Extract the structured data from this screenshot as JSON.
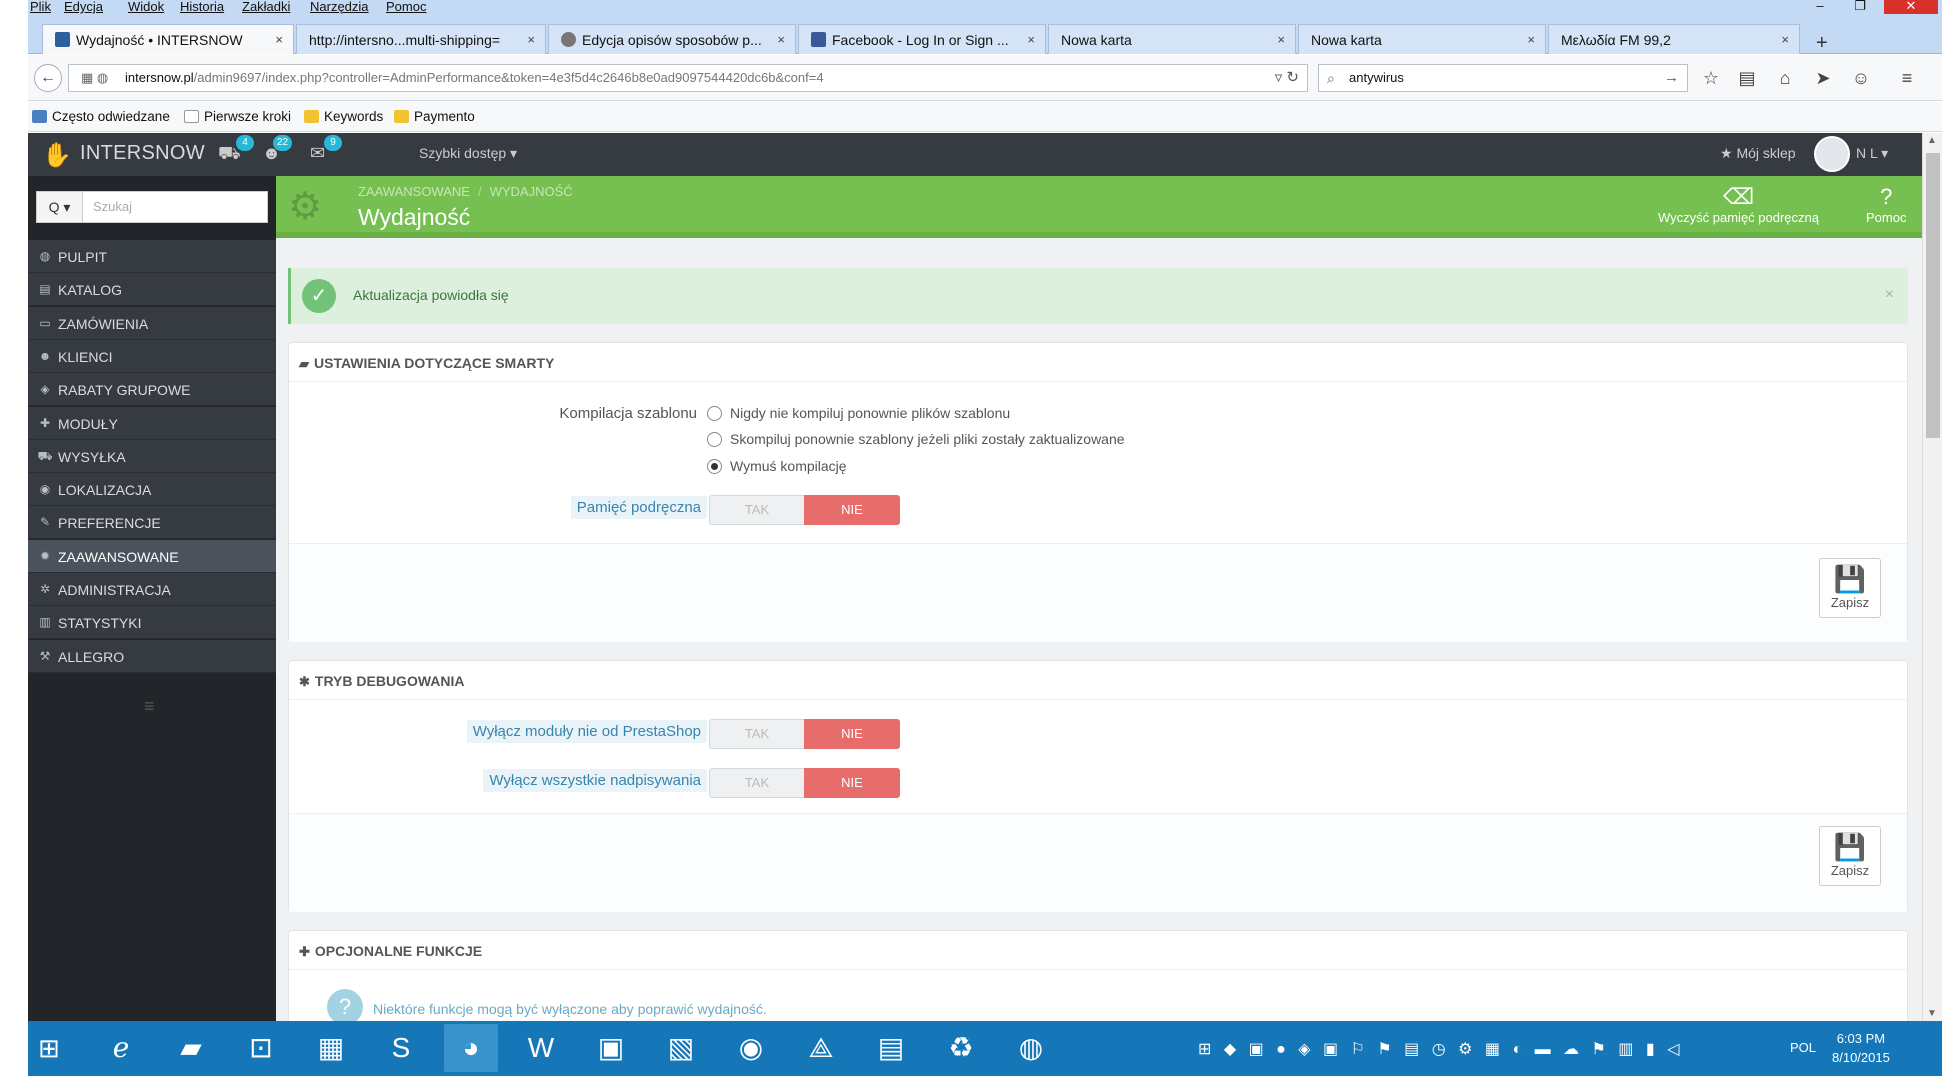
{
  "browser": {
    "menu": [
      "Plik",
      "Edycja",
      "Widok",
      "Historia",
      "Zakładki",
      "Narzędzia",
      "Pomoc"
    ],
    "window_controls": {
      "minimize": "–",
      "restore": "❐",
      "close": "✕"
    },
    "tabs": [
      {
        "label": "Wydajność • INTERSNOW",
        "icon_color": "#2d5f9e"
      },
      {
        "label": "http://intersno...multi-shipping=",
        "icon_color": ""
      },
      {
        "label": "Edycja opisów sposobów p...",
        "icon_color": "#777777"
      },
      {
        "label": "Facebook - Log In or Sign ...",
        "icon_color": "#3b5998"
      },
      {
        "label": "Nowa karta",
        "icon_color": ""
      },
      {
        "label": "Nowa karta",
        "icon_color": ""
      },
      {
        "label": "Μελωδία FM 99,2",
        "icon_color": ""
      }
    ],
    "tab_close": "×",
    "new_tab": "+",
    "url_host": "intersnow.pl",
    "url_path": "/admin9697/index.php?controller=AdminPerformance&token=4e3f5d4c2646b8e0ad9097544420dc6b&conf=4",
    "search_value": "antywirus",
    "bookmarks": [
      {
        "label": "Często odwiedzane",
        "icon_color": "#4a7fc1"
      },
      {
        "label": "Pierwsze kroki",
        "icon_color": "#ffffff"
      },
      {
        "label": "Keywords",
        "icon_color": "#f1c232"
      },
      {
        "label": "Paymento",
        "icon_color": "#f1c232"
      }
    ]
  },
  "admin": {
    "shop_name": "INTERSNOW",
    "badges": {
      "orders": "4",
      "customers": "22",
      "messages": "9"
    },
    "quick_access": "Szybki dostęp ▾",
    "my_shop": "★ Mój sklep",
    "user": "N L ▾",
    "search_placeholder": "Szukaj",
    "search_button": "Q ▾",
    "sidebar": [
      {
        "label": "PULPIT",
        "icon": "◍",
        "icon_name": "dashboard-icon"
      },
      {
        "label": "KATALOG",
        "icon": "▤",
        "icon_name": "catalog-icon"
      },
      {
        "label": "ZAMÓWIENIA",
        "icon": "▭",
        "icon_name": "orders-icon"
      },
      {
        "label": "KLIENCI",
        "icon": "☻",
        "icon_name": "customers-icon"
      },
      {
        "label": "RABATY GRUPOWE",
        "icon": "◈",
        "icon_name": "tag-icon"
      },
      {
        "label": "MODUŁY",
        "icon": "✚",
        "icon_name": "puzzle-icon"
      },
      {
        "label": "WYSYŁKA",
        "icon": "⛟",
        "icon_name": "truck-icon"
      },
      {
        "label": "LOKALIZACJA",
        "icon": "◉",
        "icon_name": "globe-icon"
      },
      {
        "label": "PREFERENCJE",
        "icon": "✎",
        "icon_name": "wrench-icon"
      },
      {
        "label": "ZAAWANSOWANE",
        "icon": "✹",
        "icon_name": "cogs-icon"
      },
      {
        "label": "ADMINISTRACJA",
        "icon": "✲",
        "icon_name": "cog-icon"
      },
      {
        "label": "STATYSTYKI",
        "icon": "▥",
        "icon_name": "bar-chart-icon"
      },
      {
        "label": "ALLEGRO",
        "icon": "⚒",
        "icon_name": "gavel-icon"
      }
    ],
    "active_sidebar": "ZAAWANSOWANE",
    "breadcrumb": [
      "ZAAWANSOWANE",
      "WYDAJNOŚĆ"
    ],
    "title": "Wydajność",
    "toolbar": {
      "clear_cache": "Wyczyść pamięć podręczną",
      "help": "Pomoc"
    },
    "alert": "Aktualizacja powiodła się",
    "smarty": {
      "heading": "USTAWIENIA DOTYCZĄCE SMARTY",
      "compile_label": "Kompilacja szablonu",
      "options": [
        "Nigdy nie kompiluj ponownie plików szablonu",
        "Skompiluj ponownie szablony jeżeli pliki zostały zaktualizowane",
        "Wymuś kompilację"
      ],
      "selected_option": 2,
      "cache_label": "Pamięć podręczna"
    },
    "debug": {
      "heading": "TRYB DEBUGOWANIA",
      "disable_modules": "Wyłącz moduły nie od PrestaShop",
      "disable_overrides": "Wyłącz wszystkie nadpisywania"
    },
    "optional": {
      "heading": "OPCJONALNE FUNKCJE",
      "info": "Niektóre funkcje mogą być wyłączone aby poprawić wydajność."
    },
    "toggle_yes": "TAK",
    "toggle_no": "NIE",
    "save": "Zapisz"
  },
  "taskbar": {
    "language": "POL",
    "time": "6:03 PM",
    "date": "8/10/2015"
  },
  "colors": {
    "header_dark": "#363a41",
    "page_head_green": "#76c052",
    "toggle_no_red": "#e76d6d",
    "success_bg": "#ddf0de",
    "taskbar_blue": "#1577b8"
  }
}
